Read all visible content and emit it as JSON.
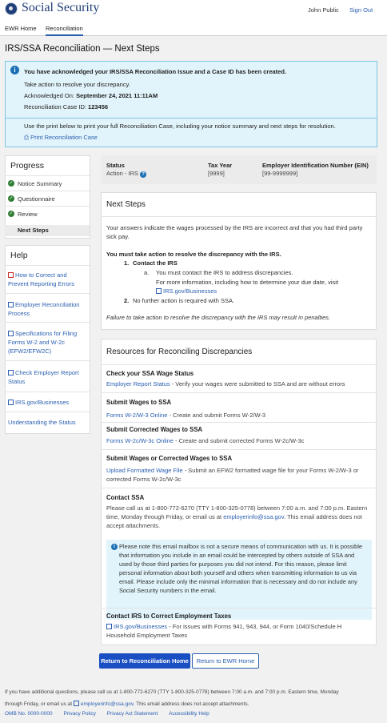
{
  "header": {
    "logo_text": "Social Security",
    "user": "John Public",
    "sign_out": "Sign Out"
  },
  "nav": {
    "tabs": [
      "EWR Home",
      "Reconciliation"
    ],
    "active": "Reconciliation"
  },
  "page_title": "IRS/SSA Reconciliation — Next Steps",
  "alert": {
    "title": "You have acknowledged your IRS/SSA Reconciliation Issue and a Case ID has been created.",
    "action": "Take action to resolve your discrepancy.",
    "ack_label": "Acknowledged On:",
    "ack_value": "September 24, 2021 11:11AM",
    "case_label": "Reconciliation Case ID:",
    "case_value": "123456",
    "print_text": "Use the print below to print your full Reconciliation Case, including your notice summary and next steps for resolution.",
    "print_link": "Print Reconciliation Case"
  },
  "progress": {
    "title": "Progress",
    "steps": [
      "Notice Summary",
      "Questionnaire",
      "Review",
      "Next Steps"
    ],
    "active": "Next Steps"
  },
  "help": {
    "title": "Help",
    "links": [
      "How to Correct and Prevent Reporting Errors",
      "Employer Reconciliation Process",
      "Specifications for Filing Forms W-2 and W-2c (EFW2/EFW2C)",
      "Check Employer Report Status",
      "IRS.gov/Businesses",
      "Understanding the Status"
    ]
  },
  "status_bar": {
    "status_label": "Status",
    "status_value": "Action - IRS",
    "tax_year_label": "Tax Year",
    "tax_year_value": "[9999]",
    "ein_label": "Employer Identification Number (EIN)",
    "ein_value": "[99-9999999]"
  },
  "next_steps": {
    "title": "Next Steps",
    "intro": "Your answers indicate the wages processed by the IRS are incorrect and that you had third party sick pay.",
    "must": "You must take action to resolve the discrepancy with the IRS.",
    "item1_num": "1.",
    "item1_title": "Contact the IRS",
    "sub_a": "a.",
    "sub_a_text": "You must contact the IRS to address discrepancies.",
    "sub_a_more": "For more information, including how to determine your due date, visit",
    "sub_a_link": "IRS.gov/Businesses",
    "item2_num": "2.",
    "item2_text": "No further action is required with SSA.",
    "warning": "Failure to take action to resolve the discrepancy with the IRS may result in penalties."
  },
  "resources": {
    "title": "Resources for Reconciling Discrepancies",
    "items": [
      {
        "title": "Check your SSA Wage Status",
        "link": "Employer Report Status",
        "desc": " - Verify your wages were submitted to SSA and are without errors"
      },
      {
        "title": "Submit Wages to SSA",
        "link": "Forms W-2/W-3 Online",
        "desc": " - Create and submit Forms W-2/W-3"
      },
      {
        "title": "Submit Corrected Wages to SSA",
        "link": "Forms W-2c/W-3c Online",
        "desc": " - Create and submit corrected Forms W-2c/W-3c"
      },
      {
        "title": "Submit Wages or Corrected Wages to SSA",
        "link": "Upload Formatted Wage File",
        "desc": " - Submit an EFW2 formatted wage file for your Forms W-2/W-3 or corrected Forms W-2c/W-3c"
      }
    ],
    "contact_title": "Contact SSA",
    "contact_text": "Please call us at 1-800-772-6270 (TTY 1-800-325-0778) between 7:00 a.m. and 7:00 p.m. Eastern time, Monday through Friday, or email us at",
    "contact_email": "employerinfo@ssa.gov",
    "contact_text2": ". This email address does not accept attachments.",
    "note": "Please note this email mailbox is not a secure means of communication with us. It is possible that information you include in an email could be intercepted by others outside of SSA and used by those third parties for purposes you did not intend. For this reason, please limit personal information about both yourself and others when transmitting information to us via email. Please include only the minimal information that is necessary and do not include any Social Security numbers in the email.",
    "irs_title": "Contact IRS to Correct Employment Taxes",
    "irs_link": "IRS.gov/Businesses",
    "irs_desc": " - For issues with Forms 941, 943, 944, or Form 1040/Schedule H Household Employment Taxes"
  },
  "buttons": {
    "return_recon": "Return to Reconciliation Home",
    "return_ewr": "Return to EWR Home"
  },
  "footer": {
    "line1": "If you have additional questions, please call us at 1-800-772-6270 (TTY 1-800-325-0778) between 7:00 a.m. and 7:00 p.m. Eastern time, Monday",
    "line2a": "through Friday, or email us at",
    "line2_email": "employerinfo@ssa.gov",
    "line2b": ". This email address does not accept attachments.",
    "links": [
      "OMB No. 0000-0000",
      "Privacy Policy",
      "Privacy Act Statement",
      "Accessibility Help"
    ]
  },
  "colors": {
    "primary_blue": "#1a4fc4",
    "link_blue": "#2a5fb0",
    "alert_bg": "#e2f4fb",
    "check_green": "#2e7d32"
  }
}
